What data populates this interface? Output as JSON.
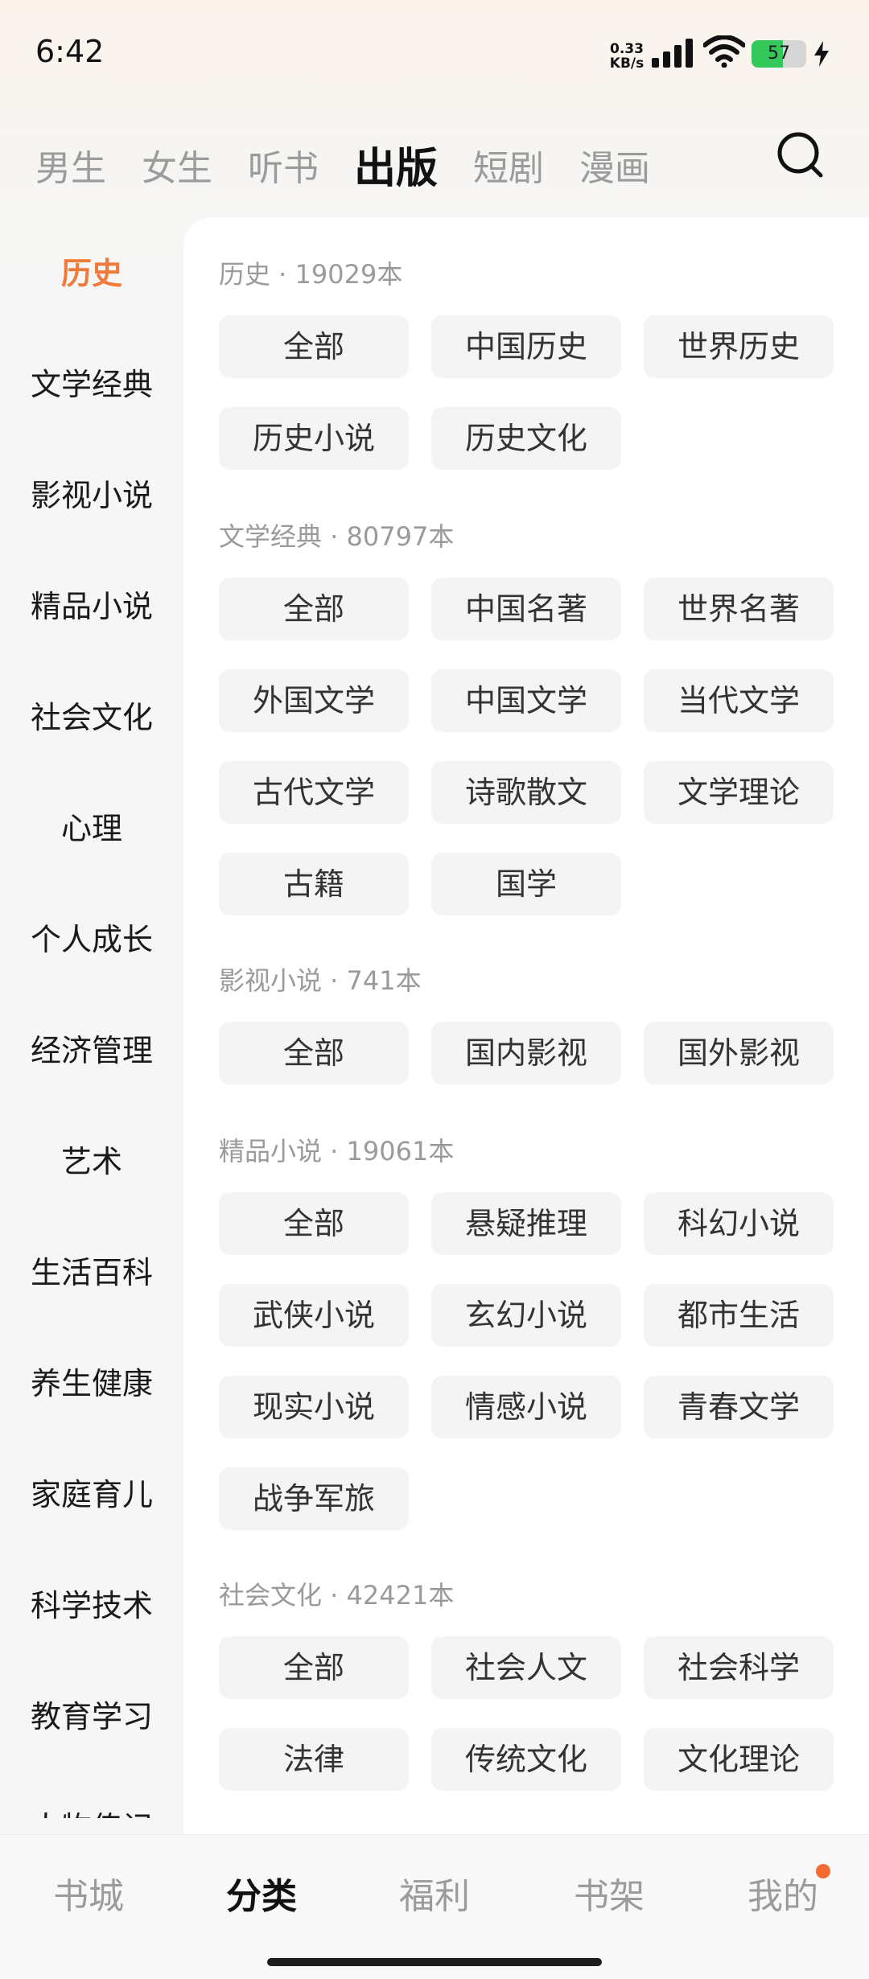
{
  "status": {
    "time": "6:42",
    "speed_value": "0.33",
    "speed_unit": "KB/s",
    "battery": "57",
    "battery_level": 0.57
  },
  "top_tabs": [
    "男生",
    "女生",
    "听书",
    "出版",
    "短剧",
    "漫画"
  ],
  "top_tab_active": "出版",
  "sidebar": {
    "active": "历史",
    "items": [
      "历史",
      "文学经典",
      "影视小说",
      "精品小说",
      "社会文化",
      "心理",
      "个人成长",
      "经济管理",
      "艺术",
      "生活百科",
      "养生健康",
      "家庭育儿",
      "科学技术",
      "教育学习",
      "人物传记"
    ]
  },
  "sections": [
    {
      "title": "历史 · 19029本",
      "chips": [
        "全部",
        "中国历史",
        "世界历史",
        "历史小说",
        "历史文化"
      ]
    },
    {
      "title": "文学经典 · 80797本",
      "chips": [
        "全部",
        "中国名著",
        "世界名著",
        "外国文学",
        "中国文学",
        "当代文学",
        "古代文学",
        "诗歌散文",
        "文学理论",
        "古籍",
        "国学"
      ]
    },
    {
      "title": "影视小说 · 741本",
      "chips": [
        "全部",
        "国内影视",
        "国外影视"
      ]
    },
    {
      "title": "精品小说 · 19061本",
      "chips": [
        "全部",
        "悬疑推理",
        "科幻小说",
        "武侠小说",
        "玄幻小说",
        "都市生活",
        "现实小说",
        "情感小说",
        "青春文学",
        "战争军旅"
      ]
    },
    {
      "title": "社会文化 · 42421本",
      "chips": [
        "全部",
        "社会人文",
        "社会科学",
        "法律",
        "传统文化",
        "文化理论"
      ]
    }
  ],
  "bottom_nav": {
    "items": [
      "书城",
      "分类",
      "福利",
      "书架",
      "我的"
    ],
    "active": "分类",
    "badge_on": "我的"
  },
  "colors": {
    "accent": "#f07a3a",
    "badge": "#f26b32",
    "battery": "#34c759"
  },
  "icons": {
    "search": "search-icon",
    "signal": "signal-icon",
    "wifi": "wifi-icon",
    "charging": "charging-icon"
  }
}
